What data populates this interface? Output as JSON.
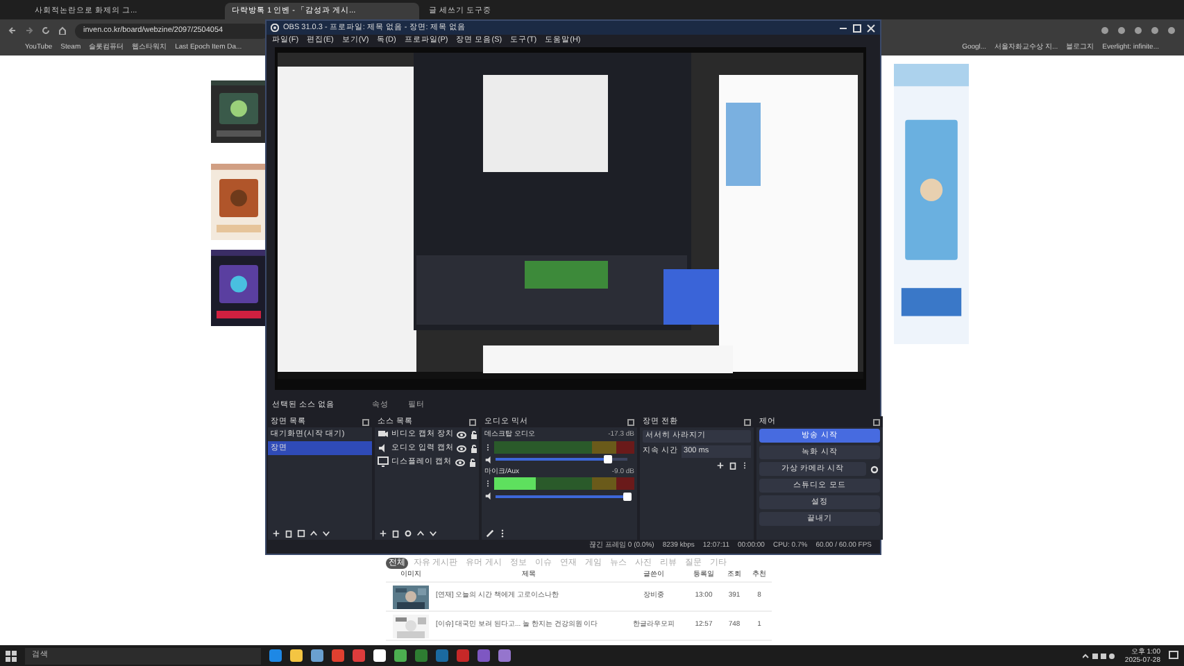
{
  "browser": {
    "tabs": [
      {
        "title": "사회적논란으로 화제의 그...",
        "selected": false
      },
      {
        "title": "다락방톡 1 인벤 - 「감성과 게시...",
        "selected": true
      },
      {
        "title": "글 세쓰기 도구중",
        "selected": false
      }
    ],
    "address": "inven.co.kr/board/webzine/2097/2504054",
    "bookmarks": [
      "YouTube",
      "Steam",
      "슬롯컴퓨터",
      "웹스타워치",
      "Last Epoch Item Da..."
    ],
    "bookmarks_right": [
      "Googl...",
      "서울자화교수상 지...",
      "블로그지",
      "Everlight: infinite..."
    ]
  },
  "obs": {
    "title": "OBS 31.0.3 - 프로파일: 제목 없음 - 장면: 제목 없음",
    "menu": [
      "파일(F)",
      "편집(E)",
      "보기(V)",
      "독(D)",
      "프로파일(P)",
      "장면 모음(S)",
      "도구(T)",
      "도움말(H)"
    ],
    "source_label": "선택된 소스 없음",
    "source_buttons": [
      "속성",
      "필터"
    ],
    "scenes": {
      "title": "장면 목록",
      "items": [
        {
          "name": "대기화면(시작 대기)",
          "selected": false
        },
        {
          "name": "장면",
          "selected": true
        }
      ]
    },
    "sources": {
      "title": "소스 목록",
      "items": [
        {
          "name": "비디오 캡처 장치",
          "kind": "camera"
        },
        {
          "name": "오디오 입력 캡처",
          "kind": "audio"
        },
        {
          "name": "디스플레이 캡처",
          "kind": "display"
        }
      ]
    },
    "mixer": {
      "title": "오디오 믹서",
      "channels": [
        {
          "name": "데스크탑 오디오",
          "reading": "-17.3 dB",
          "fader": {
            "level": 0.85
          }
        },
        {
          "name": "마이크/Aux",
          "reading": "-9.0 dB",
          "meter": {
            "level": 0.3
          },
          "fader": {
            "level": 1
          }
        }
      ]
    },
    "transitions": {
      "title": "장면 전환",
      "type": "서서히 사라지기",
      "duration_label": "지속 시간",
      "duration": "300 ms"
    },
    "controls": {
      "title": "제어",
      "buttons": [
        {
          "label": "방송 시작",
          "highlighted": true
        },
        {
          "label": "녹화 시작",
          "highlighted": false
        },
        {
          "label": "가상 카메라 시작",
          "highlighted": false
        },
        {
          "label": "스튜디오 모드",
          "highlighted": false
        },
        {
          "label": "설정",
          "highlighted": false
        },
        {
          "label": "끝내기",
          "highlighted": false
        }
      ]
    },
    "status": [
      "끊긴 프레임 0 (0.0%)",
      "8239 kbps",
      "12:07:11",
      "00:00:00",
      "CPU: 0.7%",
      "60.00 / 60.00 FPS"
    ]
  },
  "page": {
    "board_tabs": [
      {
        "label": "전체",
        "selected": true
      },
      {
        "label": "자유 게시판",
        "selected": false
      },
      {
        "label": "유머 게시",
        "selected": false
      },
      {
        "label": "정보",
        "selected": false
      },
      {
        "label": "이슈",
        "selected": false
      },
      {
        "label": "연재",
        "selected": false
      },
      {
        "label": "게임",
        "selected": false
      },
      {
        "label": "뉴스",
        "selected": false
      },
      {
        "label": "사진",
        "selected": false
      },
      {
        "label": "리뷰",
        "selected": false
      },
      {
        "label": "질문",
        "selected": false
      },
      {
        "label": "기타",
        "selected": false
      }
    ],
    "columns": [
      "이미지",
      "제목",
      "글쓴이",
      "등록일",
      "조회",
      "추천"
    ],
    "rows": [
      {
        "title": "[연재] 오늘의 시간 책에게 고로이스나한",
        "author": "장비중",
        "date": "13:00",
        "views": "391",
        "likes": "8"
      },
      {
        "title": "[이슈] 대국민 보려 된다고... 놀 한지는 건강의원 이다",
        "author": "한글라우모피",
        "date": "12:57",
        "views": "748",
        "likes": "1"
      }
    ]
  },
  "taskbar": {
    "search": "검색",
    "time": "오후 1:00",
    "date": "2025-07-28"
  }
}
